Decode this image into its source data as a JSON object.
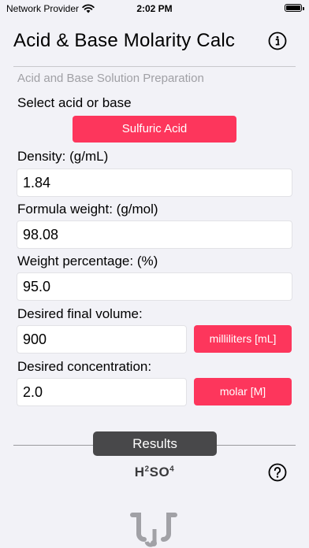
{
  "status_bar": {
    "carrier": "Network Provider",
    "time": "2:02 PM",
    "icons": [
      "wifi-icon",
      "battery-icon"
    ]
  },
  "header": {
    "title": "Acid & Base Molarity Calc",
    "info_icon": "info-icon"
  },
  "section_title": "Acid and Base Solution Preparation",
  "selector": {
    "label": "Select acid or base",
    "selected": "Sulfuric Acid"
  },
  "density": {
    "label": "Density:  (g/mL)",
    "value": "1.84"
  },
  "formula_weight": {
    "label": "Formula weight:  (g/mol)",
    "value": "98.08"
  },
  "weight_percentage": {
    "label": "Weight percentage:  (%)",
    "value": "95.0"
  },
  "final_volume": {
    "label": "Desired final volume:",
    "value": "900",
    "unit": "milliliters [mL]"
  },
  "concentration": {
    "label": "Desired concentration:",
    "value": "2.0",
    "unit": "molar [M]"
  },
  "results": {
    "tab_label": "Results",
    "formula": {
      "h": "H",
      "h_count": "2",
      "so": "SO",
      "o_count": "4"
    },
    "help_icon": "question-icon"
  },
  "colors": {
    "accent": "#fd365c",
    "background": "#f2f2f7",
    "results_tab": "#48484a"
  }
}
